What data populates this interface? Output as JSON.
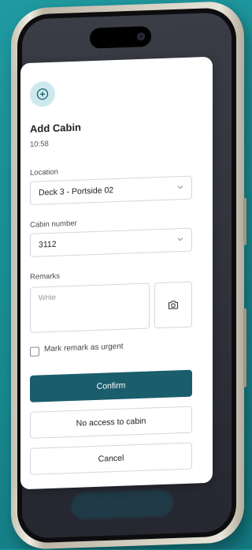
{
  "dialog": {
    "title": "Add Cabin",
    "time": "10:58",
    "location_label": "Location",
    "location_value": "Deck 3 - Portside 02",
    "cabin_label": "Cabin number",
    "cabin_value": "3112",
    "remarks_label": "Remarks",
    "remarks_placeholder": "Write",
    "urgent_label": "Mark remark as urgent",
    "urgent_checked": false,
    "confirm_label": "Confirm",
    "no_access_label": "No access to cabin",
    "cancel_label": "Cancel"
  },
  "colors": {
    "primary": "#1a5d6c",
    "icon_bg": "#cde9ee",
    "background": "#1a8f96"
  },
  "icons": {
    "add": "plus-circle-icon",
    "dropdown": "chevron-down-icon",
    "camera": "camera-icon"
  }
}
